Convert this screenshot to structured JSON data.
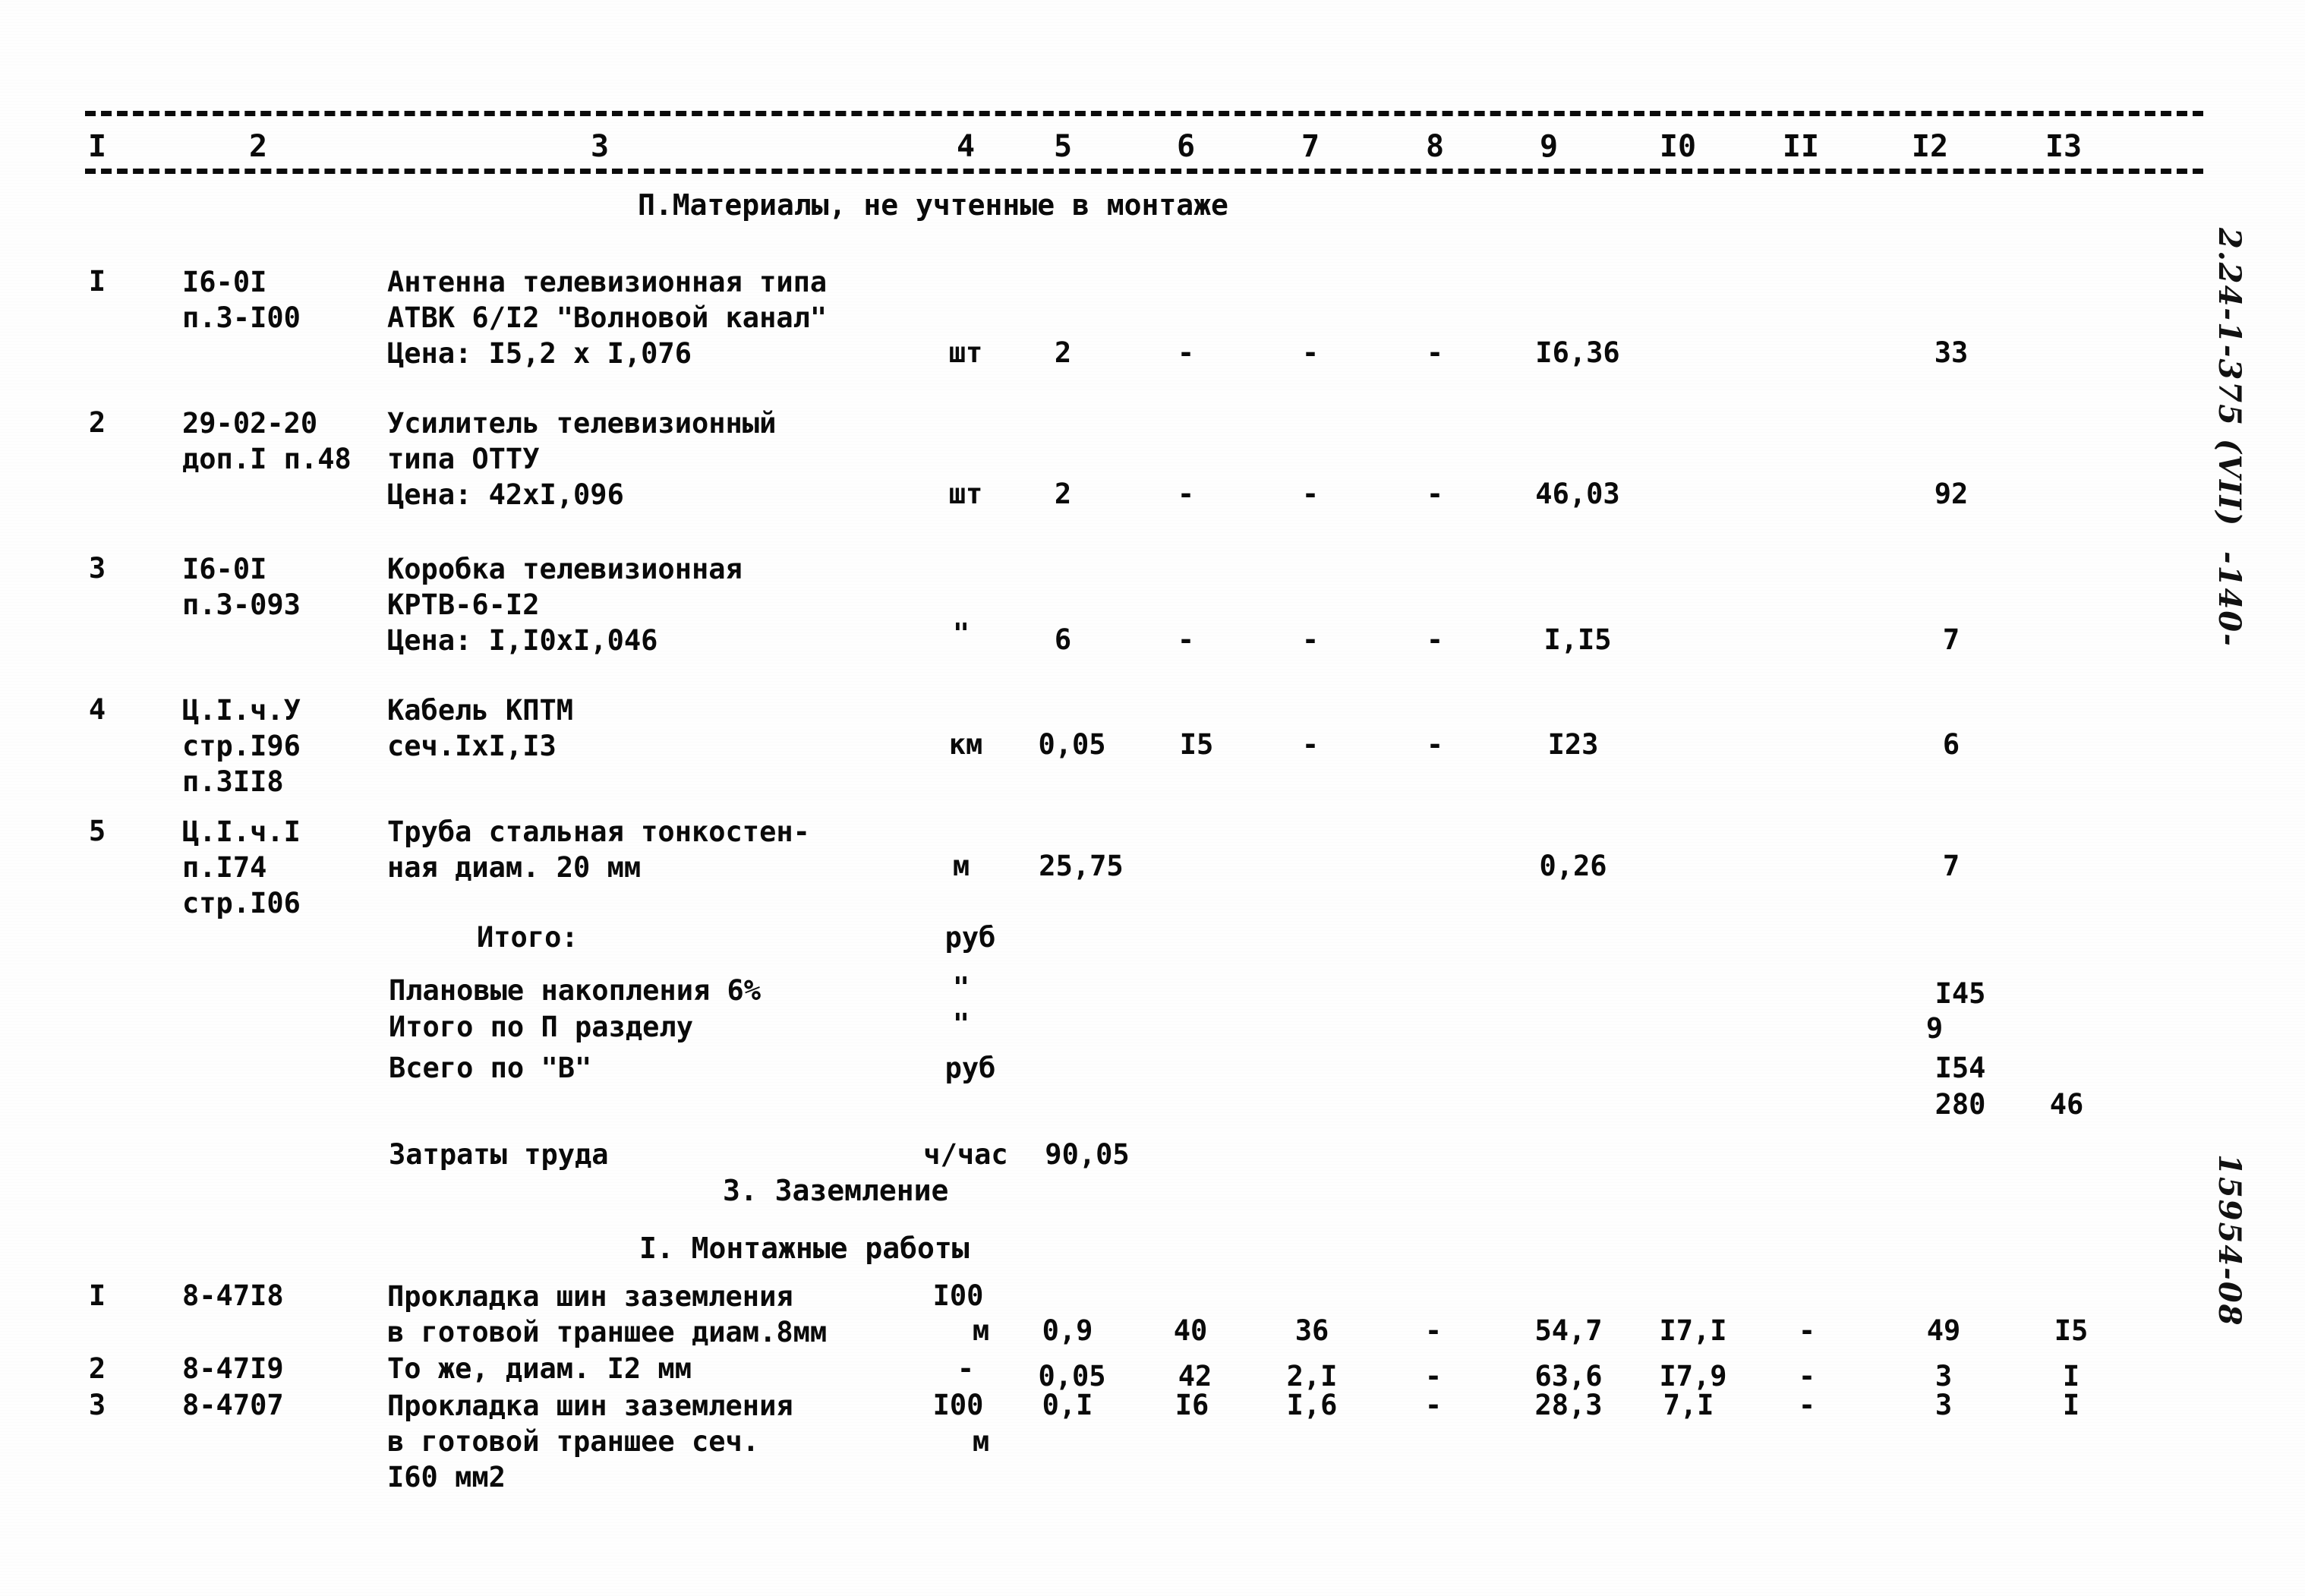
{
  "document": {
    "column_numbers": [
      "I",
      "2",
      "3",
      "4",
      "5",
      "6",
      "7",
      "8",
      "9",
      "I0",
      "II",
      "I2",
      "I3"
    ],
    "section_title_1": "П.Материалы, не учтенные в монтаже",
    "section_title_2": "3. Заземление",
    "section_title_3": "I. Монтажные работы"
  },
  "materials_rows": [
    {
      "no": "I",
      "code_line1": "I6-0I",
      "code_line2": "п.3-I00",
      "code_line3": "",
      "desc_line1": "Антенна телевизионная типа",
      "desc_line2": "АТВК 6/I2 \"Волновой канал\"",
      "desc_line3": "Цена: I5,2 х I,076",
      "unit": "шт",
      "c5": "2",
      "c6": "-",
      "c7": "-",
      "c8": "-",
      "c9": "I6,36",
      "c10": "",
      "c11": "",
      "c12": "33",
      "c13": ""
    },
    {
      "no": "2",
      "code_line1": "29-02-20",
      "code_line2": "доп.I п.48",
      "code_line3": "",
      "desc_line1": "Усилитель телевизионный",
      "desc_line2": "типа ОТТУ",
      "desc_line3": "Цена: 42хI,096",
      "unit": "шт",
      "c5": "2",
      "c6": "-",
      "c7": "-",
      "c8": "-",
      "c9": "46,03",
      "c10": "",
      "c11": "",
      "c12": "92",
      "c13": ""
    },
    {
      "no": "3",
      "code_line1": "I6-0I",
      "code_line2": "п.3-093",
      "code_line3": "",
      "desc_line1": "Коробка телевизионная",
      "desc_line2": "КРТВ-6-I2",
      "desc_line3": "Цена: I,I0хI,046",
      "unit": "\"",
      "c5": "6",
      "c6": "-",
      "c7": "-",
      "c8": "-",
      "c9": "I,I5",
      "c10": "",
      "c11": "",
      "c12": "7",
      "c13": ""
    },
    {
      "no": "4",
      "code_line1": "Ц.I.ч.У",
      "code_line2": "стр.I96",
      "code_line3": "п.3II8",
      "desc_line1": "Кабель КПТМ",
      "desc_line2": "сеч.IхI,I3",
      "desc_line3": "",
      "unit": "км",
      "c5": "0,05",
      "c6": "I5",
      "c7": "-",
      "c8": "-",
      "c9": "I23",
      "c10": "",
      "c11": "",
      "c12": "6",
      "c13": ""
    },
    {
      "no": "5",
      "code_line1": "Ц.I.ч.I",
      "code_line2": "п.I74",
      "code_line3": "стр.I06",
      "desc_line1": "Труба стальная тонкостен-",
      "desc_line2": "ная диам. 20 мм",
      "desc_line3": "",
      "unit": "м",
      "c5": "25,75",
      "c6": "",
      "c7": "",
      "c8": "",
      "c9": "0,26",
      "c10": "",
      "c11": "",
      "c12": "7",
      "c13": ""
    }
  ],
  "totals": [
    {
      "label": "Итого:",
      "unit": "руб",
      "value": "",
      "amount12": "",
      "amount13": ""
    },
    {
      "label": "Плановые накопления 6%",
      "unit": "\"",
      "value": "",
      "amount12": "I45",
      "amount13": ""
    },
    {
      "label": "Итого по П разделу",
      "unit": "\"",
      "value": "",
      "amount12": "9",
      "amount13": ""
    },
    {
      "label": "Всего по \"В\"",
      "unit": "руб",
      "value": "",
      "amount12": "I54",
      "amount13": ""
    },
    {
      "label": "",
      "unit": "",
      "value": "",
      "amount12": "280",
      "amount13": "46"
    }
  ],
  "labor": {
    "label": "Затраты труда",
    "unit": "ч/час",
    "value": "90,05"
  },
  "grounding_rows": [
    {
      "no": "I",
      "code": "8-47I8",
      "desc_line1": "Прокладка шин заземления",
      "desc_line2": "в готовой траншее диам.8мм",
      "unit_line1": "I00",
      "unit_line2": "м",
      "c5": "0,9",
      "c6": "40",
      "c7": "36",
      "c8": "-",
      "c9": "54,7",
      "c10": "I7,I",
      "c11": "-",
      "c12": "49",
      "c13": "I5"
    },
    {
      "no": "2",
      "code": "8-47I9",
      "desc_line1": "То же, диам. I2 мм",
      "desc_line2": "",
      "unit_line1": "-",
      "unit_line2": "",
      "c5": "0,05",
      "c6": "42",
      "c7": "2,I",
      "c8": "-",
      "c9": "63,6",
      "c10": "I7,9",
      "c11": "-",
      "c12": "3",
      "c13": "I"
    },
    {
      "no": "3",
      "code": "8-4707",
      "desc_line1": "Прокладка шин заземления",
      "desc_line2": "в готовой траншее сеч.",
      "desc_line3": "I60 мм2",
      "unit_line1": "I00",
      "unit_line2": "м",
      "c5": "0,I",
      "c6": "I6",
      "c7": "I,6",
      "c8": "-",
      "c9": "28,3",
      "c10": "7,I",
      "c11": "-",
      "c12": "3",
      "c13": "I"
    }
  ],
  "margin_notes": {
    "top": "2.24-1-375 (VII)  -140-",
    "bottom": "15954-08"
  }
}
